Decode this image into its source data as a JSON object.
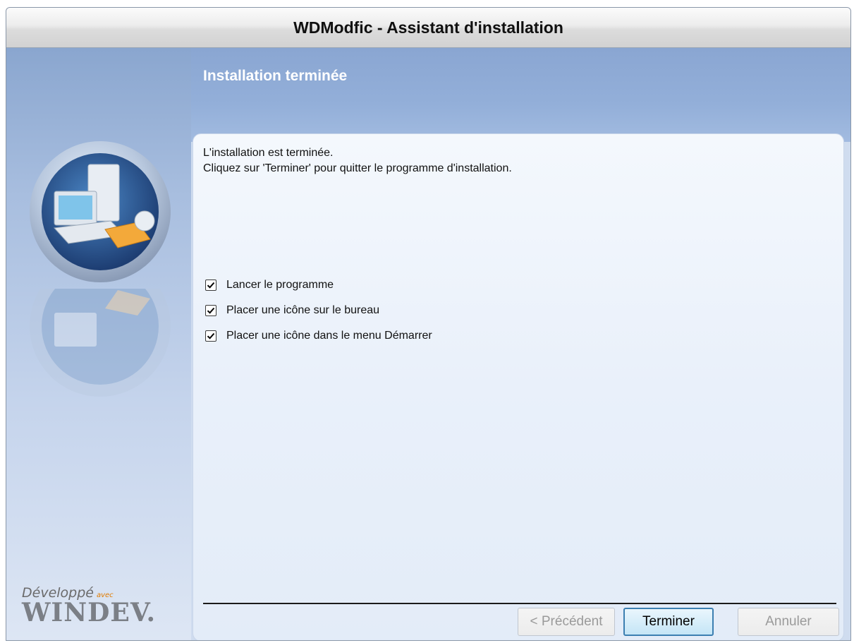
{
  "window": {
    "title": "WDModfic - Assistant d'installation"
  },
  "header": {
    "title": "Installation terminée"
  },
  "message": {
    "line1": "L'installation est terminée.",
    "line2": "Cliquez sur 'Terminer' pour quitter le programme d'installation."
  },
  "options": [
    {
      "label": "Lancer le programme",
      "checked": true
    },
    {
      "label": "Placer une icône sur le bureau",
      "checked": true
    },
    {
      "label": "Placer une icône dans le menu Démarrer",
      "checked": true
    }
  ],
  "buttons": {
    "previous": {
      "label": "< Précédent",
      "enabled": false
    },
    "finish": {
      "label": "Terminer",
      "enabled": true
    },
    "cancel": {
      "label": "Annuler",
      "enabled": false
    }
  },
  "branding": {
    "line1": "Développé",
    "avec": "avec",
    "line2": "WINDEV."
  },
  "colors": {
    "accent": "#3c7fb1",
    "header": "#8aa6d2",
    "panel": "#e9f0fa"
  }
}
